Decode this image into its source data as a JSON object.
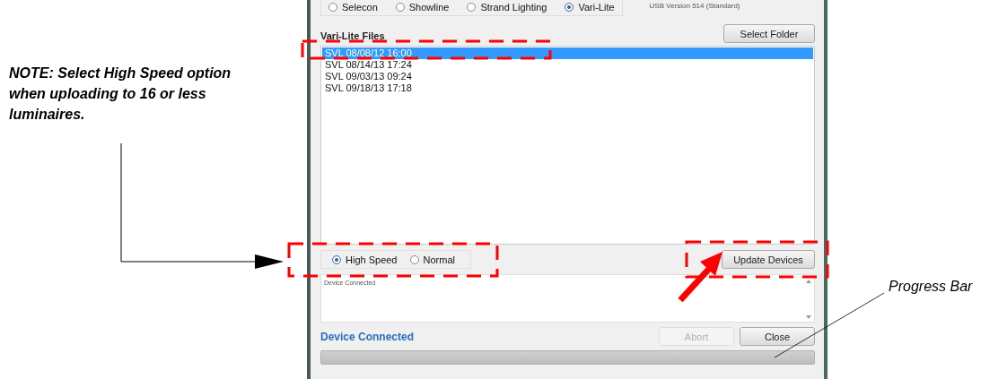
{
  "note": "NOTE: Select High Speed option when uploading to 16 or less luminaires.",
  "progress_callout": "Progress Bar",
  "window": {
    "console_options": [
      {
        "label": "Selecon",
        "selected": false
      },
      {
        "label": "Showline",
        "selected": false
      },
      {
        "label": "Strand Lighting",
        "selected": false
      },
      {
        "label": "Vari-Lite",
        "selected": true
      }
    ],
    "usb_version": "USB Version 514 (Standard)",
    "files_label": "Vari-Lite Files",
    "select_folder_button": "Select Folder",
    "files": [
      {
        "label": "SVL 08/08/12 16:00",
        "selected": true
      },
      {
        "label": "SVL 08/14/13 17:24",
        "selected": false
      },
      {
        "label": "SVL 09/03/13 09:24",
        "selected": false
      },
      {
        "label": "SVL 09/18/13 17:18",
        "selected": false
      }
    ],
    "speed_options": [
      {
        "label": "High Speed",
        "selected": true
      },
      {
        "label": "Normal",
        "selected": false
      }
    ],
    "update_button": "Update Devices",
    "log": "Device Connected",
    "status": "Device Connected",
    "abort_button": {
      "label": "Abort",
      "disabled": true
    },
    "close_button": {
      "label": "Close",
      "disabled": false
    },
    "progress": {
      "level": 0
    }
  }
}
